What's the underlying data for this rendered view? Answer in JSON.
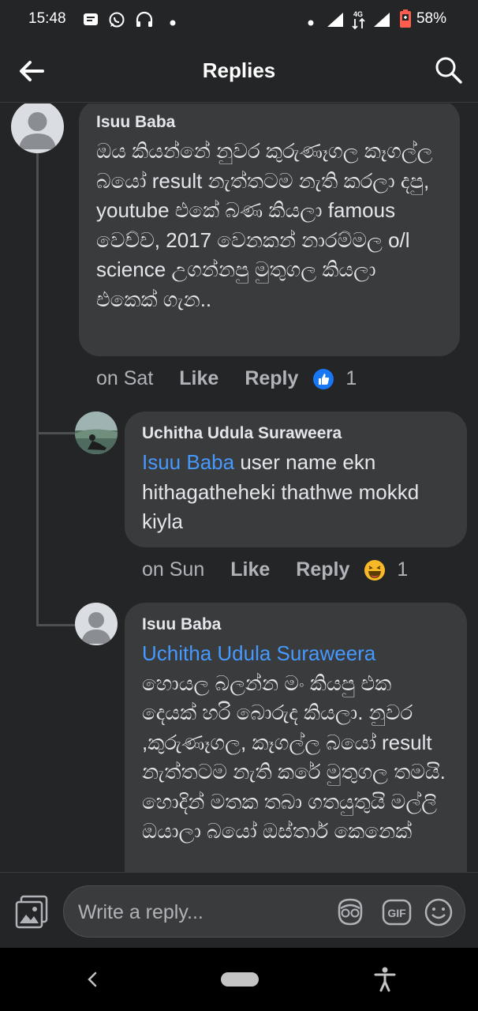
{
  "status_bar": {
    "time": "15:48",
    "battery": "58%",
    "network": "4G"
  },
  "header": {
    "title": "Replies"
  },
  "comments": [
    {
      "author": "Isuu Baba",
      "text": "ඔය කියන්නේ නුවර කුරුණෑගල කෑගල්ල බයෝ result නැත්තටම නැති කරලා දපු, youtube එකේ බණ කියලා famous වෙච්ච, 2017 වෙනකන් නාරම්මල o/l science උගන්නපු මුතුගල කියලා එකෙක් ගැන..",
      "time": "on Sat",
      "like": "Like",
      "reply": "Reply",
      "reaction": "like",
      "count": "1"
    },
    {
      "author": "Uchitha Udula Suraweera",
      "mention": "Isuu Baba",
      "text": " user name ekn hithagatheheki thathwe mokkd kiyla",
      "time": "on Sun",
      "like": "Like",
      "reply": "Reply",
      "reaction": "haha",
      "count": "1"
    },
    {
      "author": "Isuu Baba",
      "mention": "Uchitha Udula Suraweera",
      "text": "හොයල බලන්න මං කියපු එක දෙයක් හරි බොරුද කියලා. නුවර ,කුරුණෑගල, කෑගල්ල බයෝ result නැත්තටම නැති කරේ මුතුගල තමයි. හොදින් මතක තබා ගතයුතුයි මල්ලි ඔයාලා බයෝ ඔස්තාර් කෙනෙක්"
    }
  ],
  "composer": {
    "placeholder": "Write a reply..."
  },
  "colors": {
    "background": "#242527",
    "bubble": "#3a3b3c",
    "mention": "#4599ff",
    "like_blue": "#1877f2"
  }
}
